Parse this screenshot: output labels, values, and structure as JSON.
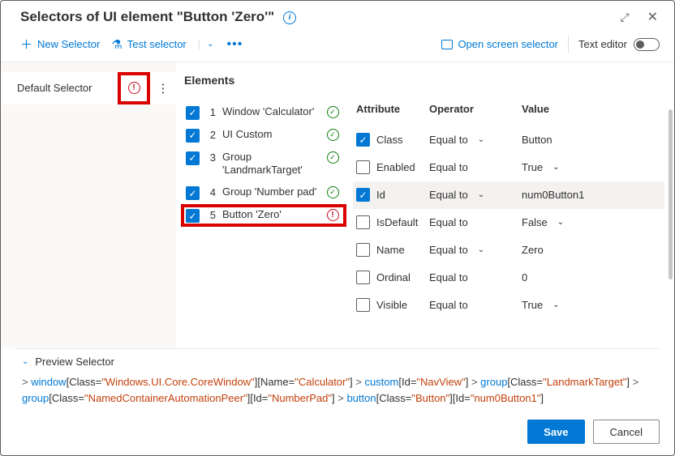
{
  "title": "Selectors of UI element \"Button 'Zero'\"",
  "toolbar": {
    "new_selector": "New Selector",
    "test_selector": "Test selector",
    "open_screen": "Open screen selector",
    "text_editor": "Text editor"
  },
  "selectors": {
    "items": [
      {
        "label": "Default Selector",
        "status": "error"
      }
    ]
  },
  "elements": {
    "heading": "Elements",
    "items": [
      {
        "n": "1",
        "label": "Window 'Calculator'",
        "status": "ok",
        "checked": true
      },
      {
        "n": "2",
        "label": "UI Custom",
        "status": "ok",
        "checked": true
      },
      {
        "n": "3",
        "label": "Group 'LandmarkTarget'",
        "status": "ok",
        "checked": true
      },
      {
        "n": "4",
        "label": "Group 'Number pad'",
        "status": "ok",
        "checked": true
      },
      {
        "n": "5",
        "label": "Button 'Zero'",
        "status": "error",
        "checked": true
      }
    ]
  },
  "attrs": {
    "head_attr": "Attribute",
    "head_op": "Operator",
    "head_val": "Value",
    "rows": [
      {
        "checked": true,
        "attr": "Class",
        "op": "Equal to",
        "val": "Button",
        "op_chev": true,
        "val_chev": false,
        "selected": false
      },
      {
        "checked": false,
        "attr": "Enabled",
        "op": "Equal to",
        "val": "True",
        "op_chev": false,
        "val_chev": true,
        "selected": false
      },
      {
        "checked": true,
        "attr": "Id",
        "op": "Equal to",
        "val": "num0Button1",
        "op_chev": true,
        "val_chev": false,
        "selected": true
      },
      {
        "checked": false,
        "attr": "IsDefault",
        "op": "Equal to",
        "val": "False",
        "op_chev": false,
        "val_chev": true,
        "selected": false
      },
      {
        "checked": false,
        "attr": "Name",
        "op": "Equal to",
        "val": "Zero",
        "op_chev": true,
        "val_chev": false,
        "selected": false
      },
      {
        "checked": false,
        "attr": "Ordinal",
        "op": "Equal to",
        "val": "0",
        "op_chev": false,
        "val_chev": false,
        "selected": false
      },
      {
        "checked": false,
        "attr": "Visible",
        "op": "Equal to",
        "val": "True",
        "op_chev": false,
        "val_chev": true,
        "selected": false
      }
    ]
  },
  "preview": {
    "label": "Preview Selector",
    "parts": [
      {
        "tag": "window",
        "q": "[Class=\"Windows.UI.Core.CoreWindow\"][Name=\"Calculator\"]"
      },
      {
        "tag": "custom",
        "q": "[Id=\"NavView\"]"
      },
      {
        "tag": "group",
        "q": "[Class=\"LandmarkTarget\"]"
      },
      {
        "tag": "group",
        "q": "[Class=\"NamedContainerAutomationPeer\"][Id=\"NumberPad\"]"
      },
      {
        "tag": "button",
        "q": "[Class=\"Button\"][Id=\"num0Button1\"]"
      }
    ]
  },
  "buttons": {
    "save": "Save",
    "cancel": "Cancel"
  }
}
